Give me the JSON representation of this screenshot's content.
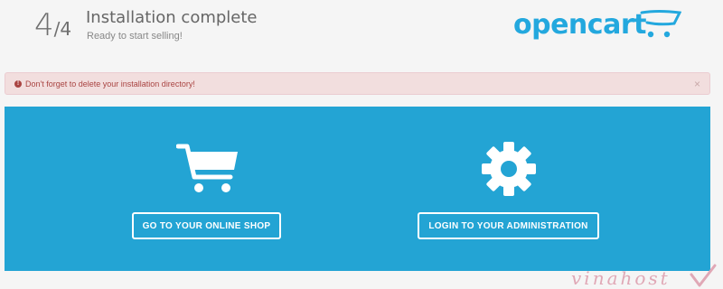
{
  "header": {
    "step_current": "4",
    "step_total": "/4",
    "title": "Installation complete",
    "subtitle": "Ready to start selling!",
    "logo_text": "opencart"
  },
  "alert": {
    "icon": "exclamation-circle-icon",
    "message": "Don't forget to delete your installation directory!",
    "close_label": "×"
  },
  "actions": {
    "shop_icon": "shopping-cart-icon",
    "shop_label": "GO TO YOUR ONLINE SHOP",
    "admin_icon": "gear-icon",
    "admin_label": "LOGIN TO YOUR ADMINISTRATION"
  },
  "watermark": {
    "text": "vinahost"
  },
  "colors": {
    "brand_blue": "#23a4d4",
    "logo_blue": "#23a8de",
    "alert_bg": "#f2dede",
    "alert_text": "#a94442"
  }
}
